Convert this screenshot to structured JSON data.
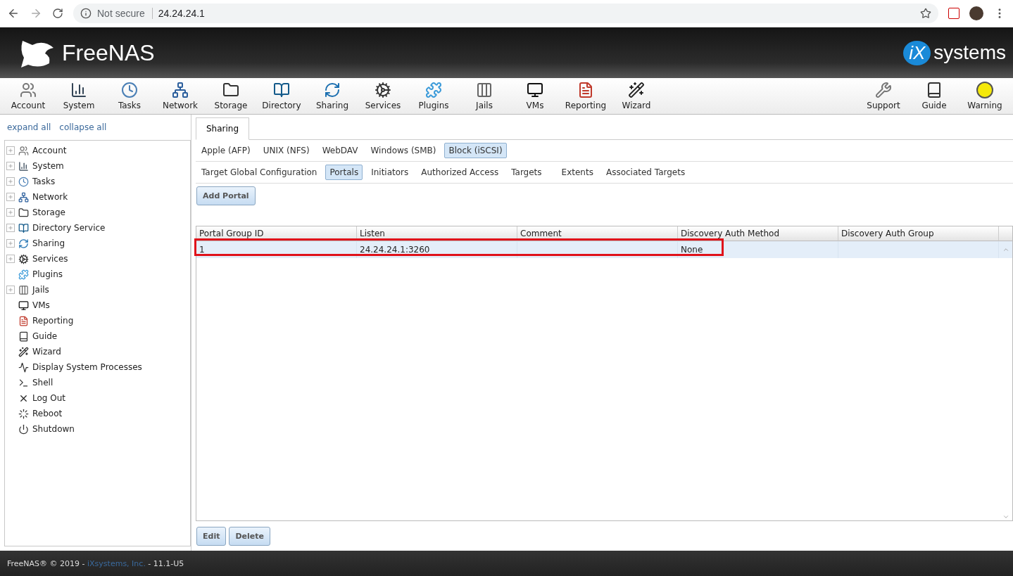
{
  "browser": {
    "security": "Not secure",
    "url": "24.24.24.1"
  },
  "header": {
    "logo": "FreeNAS",
    "brand": "systems",
    "brand_mark": "iX"
  },
  "toolbar": {
    "items": [
      {
        "label": "Account"
      },
      {
        "label": "System"
      },
      {
        "label": "Tasks"
      },
      {
        "label": "Network"
      },
      {
        "label": "Storage"
      },
      {
        "label": "Directory"
      },
      {
        "label": "Sharing"
      },
      {
        "label": "Services"
      },
      {
        "label": "Plugins"
      },
      {
        "label": "Jails"
      },
      {
        "label": "VMs"
      },
      {
        "label": "Reporting"
      },
      {
        "label": "Wizard"
      }
    ],
    "right_items": [
      {
        "label": "Support"
      },
      {
        "label": "Guide"
      },
      {
        "label": "Warning"
      }
    ]
  },
  "sidebar": {
    "links": [
      "expand all",
      "collapse all"
    ],
    "items": [
      {
        "label": "Account",
        "expandable": true
      },
      {
        "label": "System",
        "expandable": true
      },
      {
        "label": "Tasks",
        "expandable": true
      },
      {
        "label": "Network",
        "expandable": true
      },
      {
        "label": "Storage",
        "expandable": true
      },
      {
        "label": "Directory Service",
        "expandable": true
      },
      {
        "label": "Sharing",
        "expandable": true
      },
      {
        "label": "Services",
        "expandable": true
      },
      {
        "label": "Plugins",
        "expandable": false
      },
      {
        "label": "Jails",
        "expandable": true
      },
      {
        "label": "VMs",
        "expandable": false
      },
      {
        "label": "Reporting",
        "expandable": false
      },
      {
        "label": "Guide",
        "expandable": false
      },
      {
        "label": "Wizard",
        "expandable": false
      },
      {
        "label": "Display System Processes",
        "expandable": false
      },
      {
        "label": "Shell",
        "expandable": false
      },
      {
        "label": "Log Out",
        "expandable": false
      },
      {
        "label": "Reboot",
        "expandable": false
      },
      {
        "label": "Shutdown",
        "expandable": false
      }
    ]
  },
  "main_tab": {
    "label": "Sharing",
    "selected": true
  },
  "share_tabs": [
    {
      "label": "Apple (AFP)",
      "selected": false
    },
    {
      "label": "UNIX (NFS)",
      "selected": false
    },
    {
      "label": "WebDAV",
      "selected": false
    },
    {
      "label": "Windows (SMB)",
      "selected": false
    },
    {
      "label": "Block (iSCSI)",
      "selected": true
    }
  ],
  "iscsi_tabs": [
    {
      "label": "Target Global Configuration",
      "selected": false
    },
    {
      "label": "Portals",
      "selected": true
    },
    {
      "label": "Initiators",
      "selected": false
    },
    {
      "label": "Authorized Access",
      "selected": false
    },
    {
      "label": "Targets",
      "selected": false
    },
    {
      "label": "Extents",
      "selected": false
    },
    {
      "label": "Associated Targets",
      "selected": false
    }
  ],
  "add_button": "Add Portal",
  "table": {
    "columns": [
      "Portal Group ID",
      "Listen",
      "Comment",
      "Discovery Auth Method",
      "Discovery Auth Group"
    ],
    "rows": [
      {
        "cells": [
          "1",
          "24.24.24.1:3260",
          "",
          "None",
          ""
        ],
        "selected": true,
        "highlighted": true
      }
    ]
  },
  "actions": [
    "Edit",
    "Delete"
  ],
  "footer": {
    "before": "FreeNAS® © 2019 - ",
    "link": "iXsystems, Inc.",
    "after": " - 11.1-U5"
  }
}
